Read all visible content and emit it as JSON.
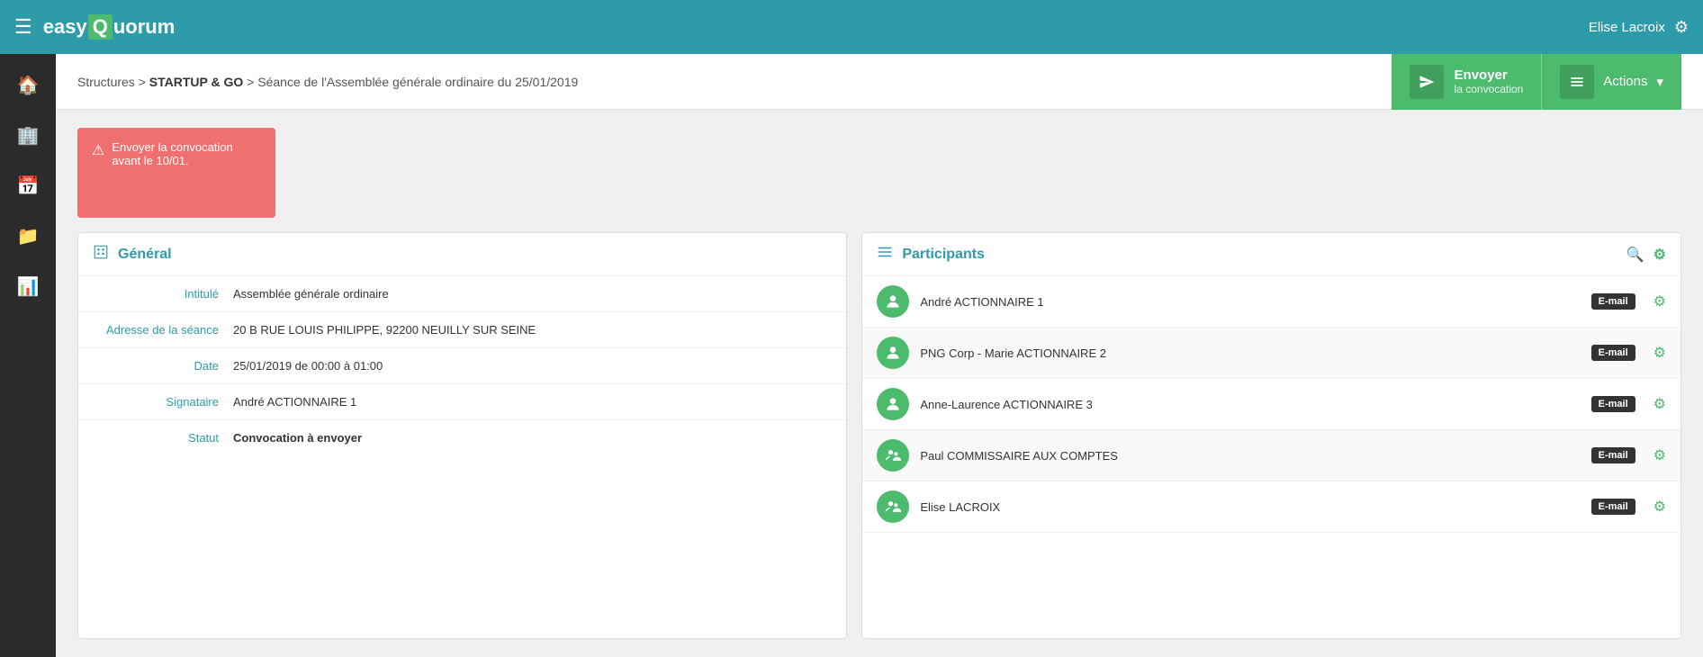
{
  "topNav": {
    "logoEasy": "easy",
    "logoQ": "Q",
    "logoRest": "uorum",
    "userName": "Elise Lacroix"
  },
  "sidebar": {
    "items": [
      {
        "icon": "🏠",
        "name": "home"
      },
      {
        "icon": "🏢",
        "name": "building"
      },
      {
        "icon": "📅",
        "name": "calendar"
      },
      {
        "icon": "📁",
        "name": "folder"
      },
      {
        "icon": "📊",
        "name": "chart"
      }
    ]
  },
  "breadcrumb": {
    "structures": "Structures",
    "startup": "STARTUP & GO",
    "separator1": " > ",
    "separator2": " > ",
    "seance": "Séance de l'Assemblée générale ordinaire du 25/01/2019"
  },
  "toolbar": {
    "envoyerLabel": "Envoyer",
    "envoyerSub": "la convocation",
    "actionsLabel": "Actions",
    "actionsArrow": "▾"
  },
  "alert": {
    "icon": "⚠",
    "text": "Envoyer la convocation avant le 10/01."
  },
  "general": {
    "title": "Général",
    "rows": [
      {
        "label": "Intitulé",
        "value": "Assemblée générale ordinaire",
        "bold": false
      },
      {
        "label": "Adresse de la séance",
        "value": "20 B RUE LOUIS PHILIPPE, 92200 NEUILLY SUR SEINE",
        "bold": false
      },
      {
        "label": "Date",
        "value": "25/01/2019 de 00:00 à 01:00",
        "bold": false
      },
      {
        "label": "Signataire",
        "value": "André ACTIONNAIRE 1",
        "bold": false
      },
      {
        "label": "Statut",
        "value": "Convocation à envoyer",
        "bold": true
      }
    ]
  },
  "participants": {
    "title": "Participants",
    "list": [
      {
        "name": "André ACTIONNAIRE 1",
        "badge": "E-mail",
        "avatarAlt": "person"
      },
      {
        "name": "PNG Corp - Marie ACTIONNAIRE 2",
        "badge": "E-mail",
        "avatarAlt": "person"
      },
      {
        "name": "Anne-Laurence ACTIONNAIRE 3",
        "badge": "E-mail",
        "avatarAlt": "person"
      },
      {
        "name": "Paul COMMISSAIRE AUX COMPTES",
        "badge": "E-mail",
        "avatarAlt": "person-group"
      },
      {
        "name": "Elise LACROIX",
        "badge": "E-mail",
        "avatarAlt": "person-group"
      }
    ]
  }
}
